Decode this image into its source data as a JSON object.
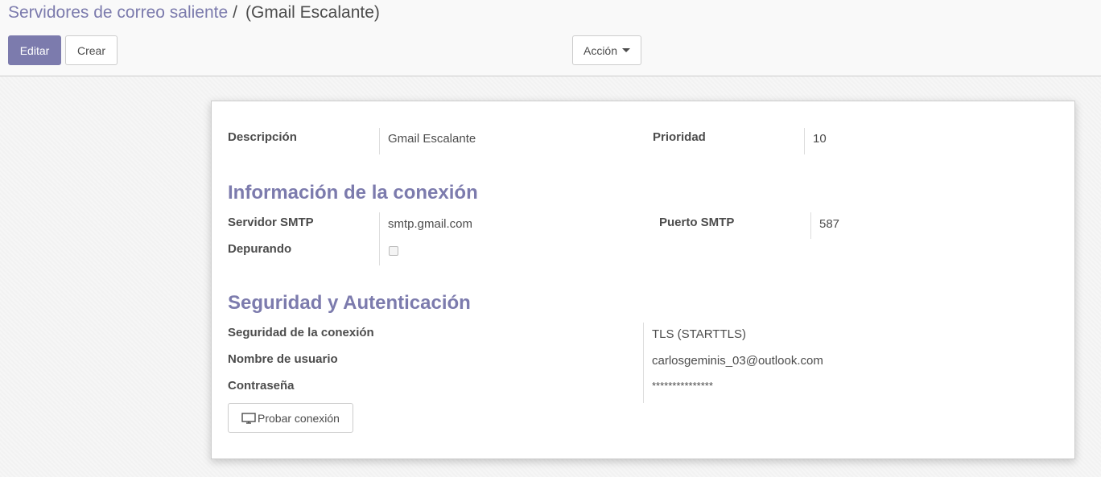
{
  "breadcrumb": {
    "parent": "Servidores de correo saliente",
    "separator": "/",
    "current": "(Gmail Escalante)"
  },
  "toolbar": {
    "edit_label": "Editar",
    "create_label": "Crear",
    "action_label": "Acción"
  },
  "form": {
    "description_label": "Descripción",
    "description_value": "Gmail Escalante",
    "priority_label": "Prioridad",
    "priority_value": "10",
    "connection_section_title": "Información de la conexión",
    "smtp_server_label": "Servidor SMTP",
    "smtp_server_value": "smtp.gmail.com",
    "smtp_port_label": "Puerto SMTP",
    "smtp_port_value": "587",
    "debugging_label": "Depurando",
    "debugging_checked": false,
    "security_section_title": "Seguridad y Autenticación",
    "connection_security_label": "Seguridad de la conexión",
    "connection_security_value": "TLS (STARTTLS)",
    "username_label": "Nombre de usuario",
    "username_value": "carlosgeminis_03@outlook.com",
    "password_label": "Contraseña",
    "password_value": "***************",
    "test_connection_label": "Probar conexión"
  },
  "colors": {
    "accent": "#7c7bad",
    "text": "#4c4c4c",
    "border": "#cccccc"
  }
}
